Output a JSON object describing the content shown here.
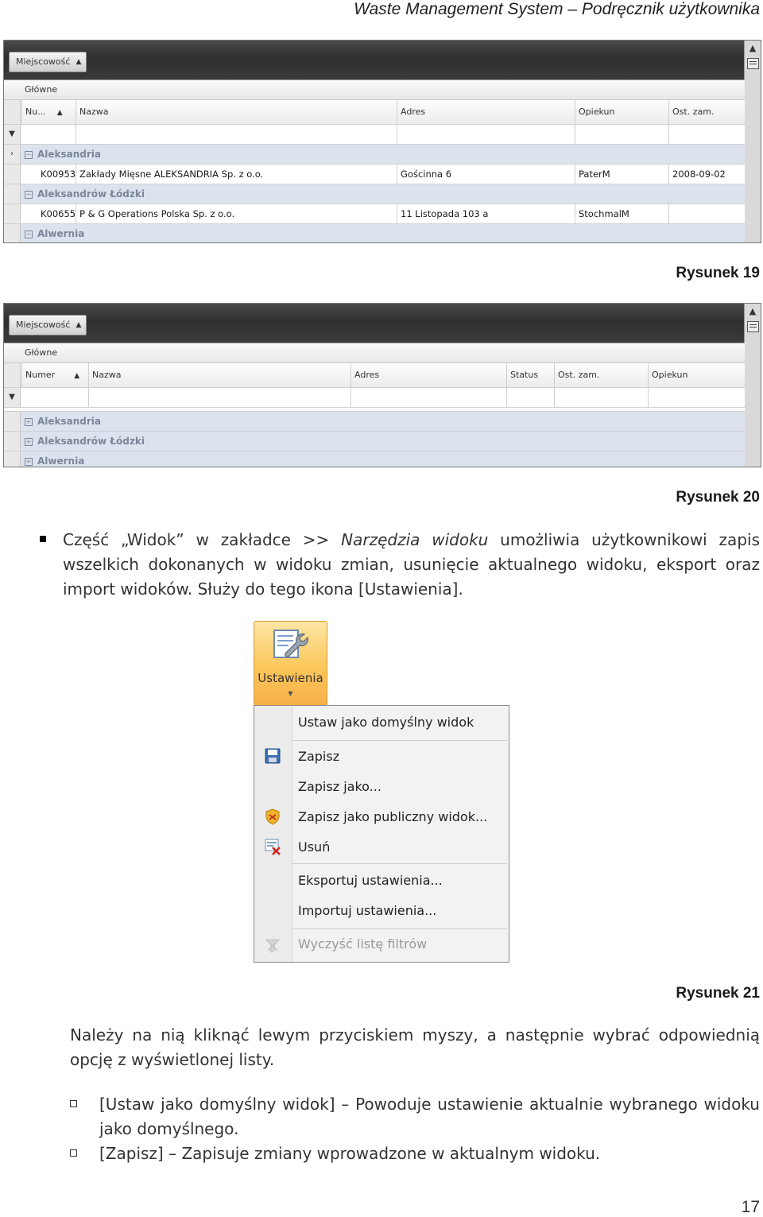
{
  "header_title": "Waste Management System – Podręcznik użytkownika",
  "fig19": {
    "group_chip": "Miejscowość",
    "band": "Główne",
    "columns": [
      "Nu...",
      "Nazwa",
      "Adres",
      "Opiekun",
      "Ost. zam."
    ],
    "groups": [
      {
        "label": "Aleksandria",
        "row": [
          "K00953",
          "Zakłady Mięsne ALEKSANDRIA Sp. z o.o.",
          "Gościnna 6",
          "PaterM",
          "2008-09-02"
        ]
      },
      {
        "label": "Aleksandrów Łódzki",
        "row": [
          "K00655",
          "P & G Operations Polska Sp. z o.o.",
          "11 Listopada 103 a",
          "StochmalM",
          ""
        ]
      },
      {
        "label": "Alwernia"
      }
    ],
    "caption": "Rysunek 19"
  },
  "fig20": {
    "group_chip": "Miejscowość",
    "band": "Główne",
    "columns": [
      "Numer",
      "Nazwa",
      "Adres",
      "Status",
      "Ost. zam.",
      "Opiekun"
    ],
    "groups": [
      "Aleksandria",
      "Aleksandrów Łódzki",
      "Alwernia"
    ],
    "caption": "Rysunek 20"
  },
  "para1": {
    "a": "Część „Widok” w zakładce >> ",
    "em": "Narzędzia widoku",
    "b": " umożliwia użytkownikowi zapis wszelkich dokonanych w widoku zmian, usunięcie aktualnego widoku, eksport oraz import widoków. Służy do tego ikona [Ustawienia]."
  },
  "button_label": "Ustawienia",
  "menu": {
    "items": [
      "Ustaw jako domyślny widok",
      "Zapisz",
      "Zapisz jako...",
      "Zapisz jako publiczny widok...",
      "Usuń",
      "Eksportuj ustawienia...",
      "Importuj ustawienia...",
      "Wyczyść listę filtrów"
    ]
  },
  "fig21_caption": "Rysunek 21",
  "para2": "Należy na nią kliknąć lewym przyciskiem myszy, a następnie wybrać odpowiednią opcję z wyświetlonej listy.",
  "bullets": [
    "[Ustaw jako domyślny widok] – Powoduje ustawienie aktualnie wybranego widoku jako domyślnego.",
    "[Zapisz] – Zapisuje zmiany wprowadzone w aktualnym widoku."
  ],
  "page_number": "17"
}
